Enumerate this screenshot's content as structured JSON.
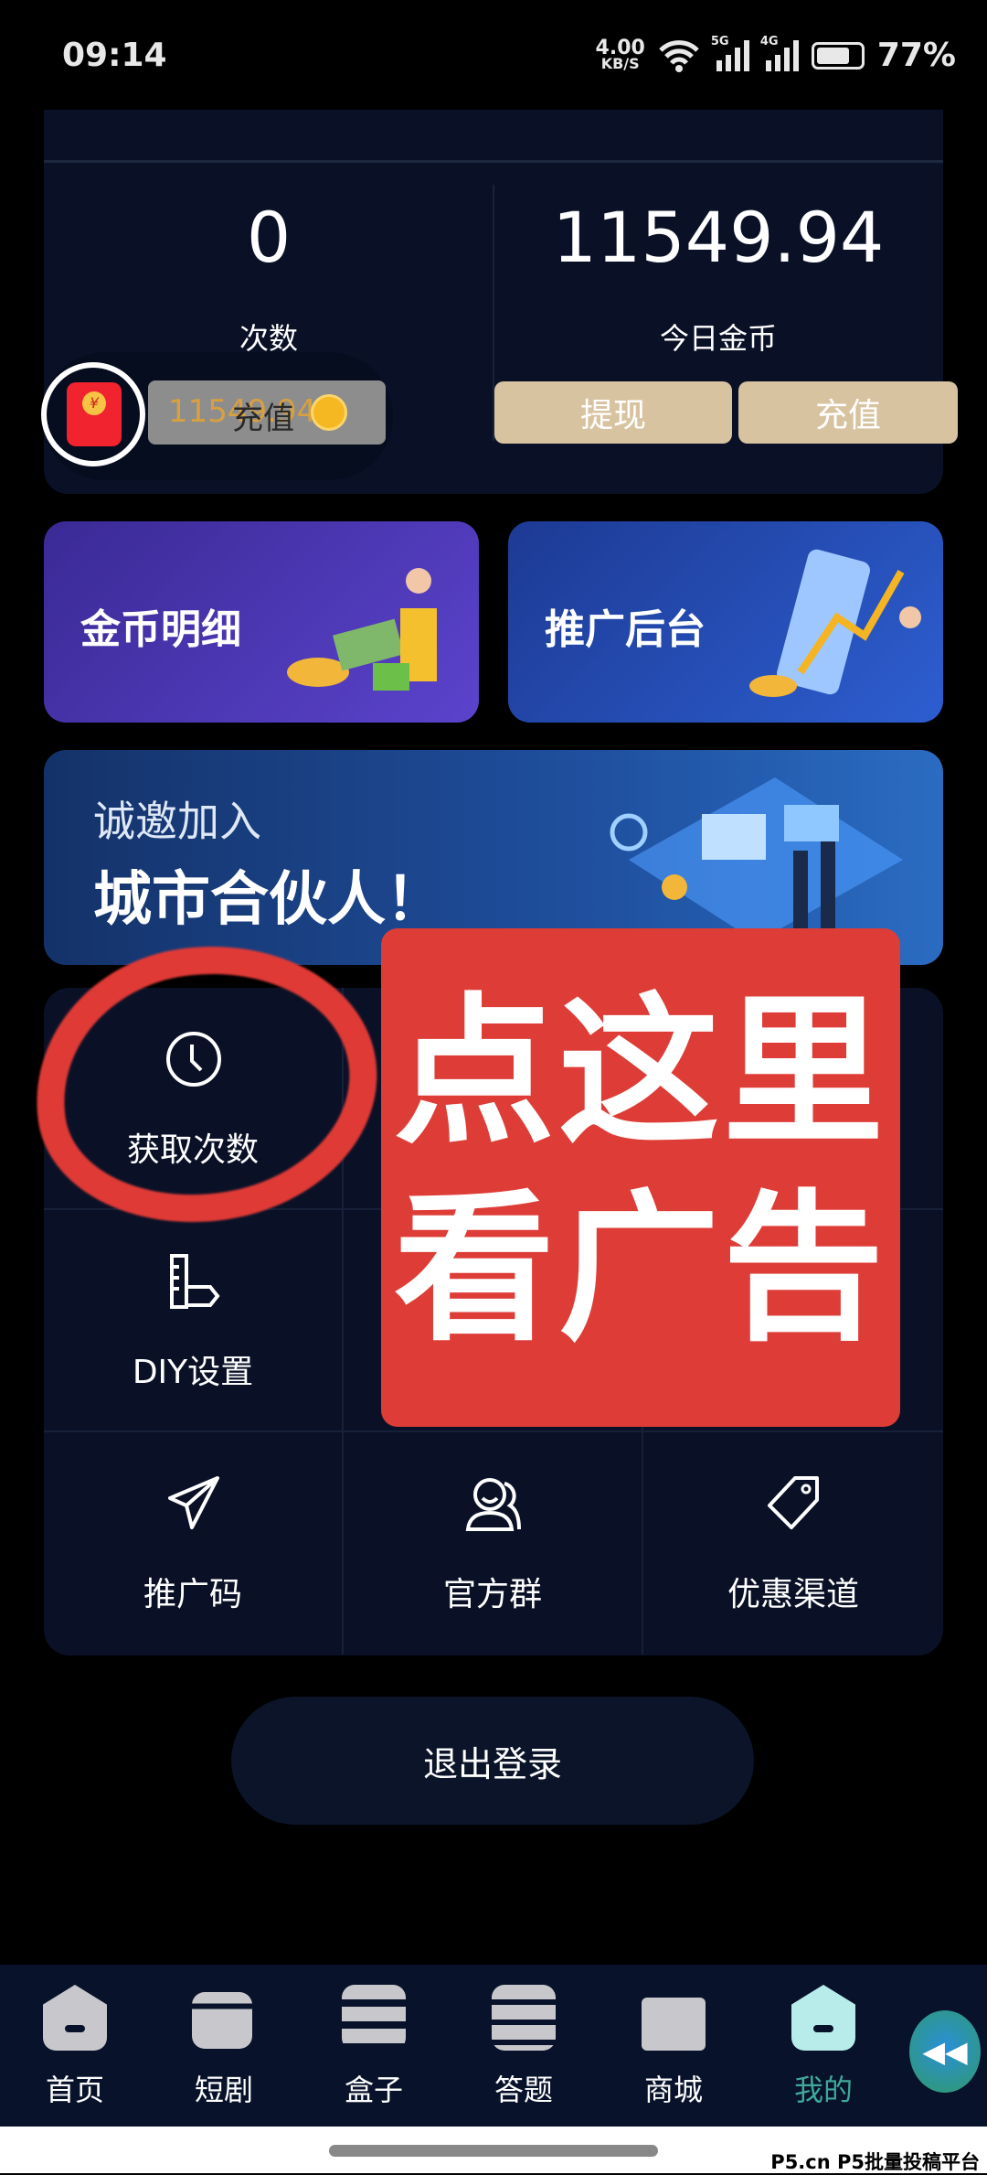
{
  "status_bar": {
    "time": "09:14",
    "net_speed": "4.00",
    "net_unit": "KB/S",
    "sig1": "5G",
    "sig2": "4G",
    "battery": "77%"
  },
  "stats": {
    "count_value": "0",
    "count_label": "次数",
    "coins_value": "11549.94",
    "coins_label": "今日金币",
    "withdraw": "提现",
    "recharge": "充值"
  },
  "floating": {
    "amount": "11549.94",
    "label": "充值"
  },
  "tiles": [
    {
      "label": "金币明细"
    },
    {
      "label": "推广后台"
    }
  ],
  "banner": {
    "line1": "诚邀加入",
    "line2": "城市合伙人！"
  },
  "grid": [
    {
      "label": "获取次数",
      "icon": "clock-icon"
    },
    {
      "label": "DIY设置",
      "icon": "ruler-pencil-icon"
    },
    {
      "label": "推广码",
      "icon": "paper-plane-icon"
    },
    {
      "label": "官方群",
      "icon": "group-icon"
    },
    {
      "label": "优惠渠道",
      "icon": "tag-icon"
    }
  ],
  "overlay": {
    "line1": "点这里",
    "line2": "看广告",
    "color": "#de3d37"
  },
  "logout": "退出登录",
  "nav": [
    {
      "label": "首页"
    },
    {
      "label": "短剧"
    },
    {
      "label": "盒子"
    },
    {
      "label": "答题"
    },
    {
      "label": "商城"
    },
    {
      "label": "我的",
      "active": true
    }
  ],
  "active_color": "#3fa89a",
  "watermark": "P5.cn P5批量投稿平台"
}
